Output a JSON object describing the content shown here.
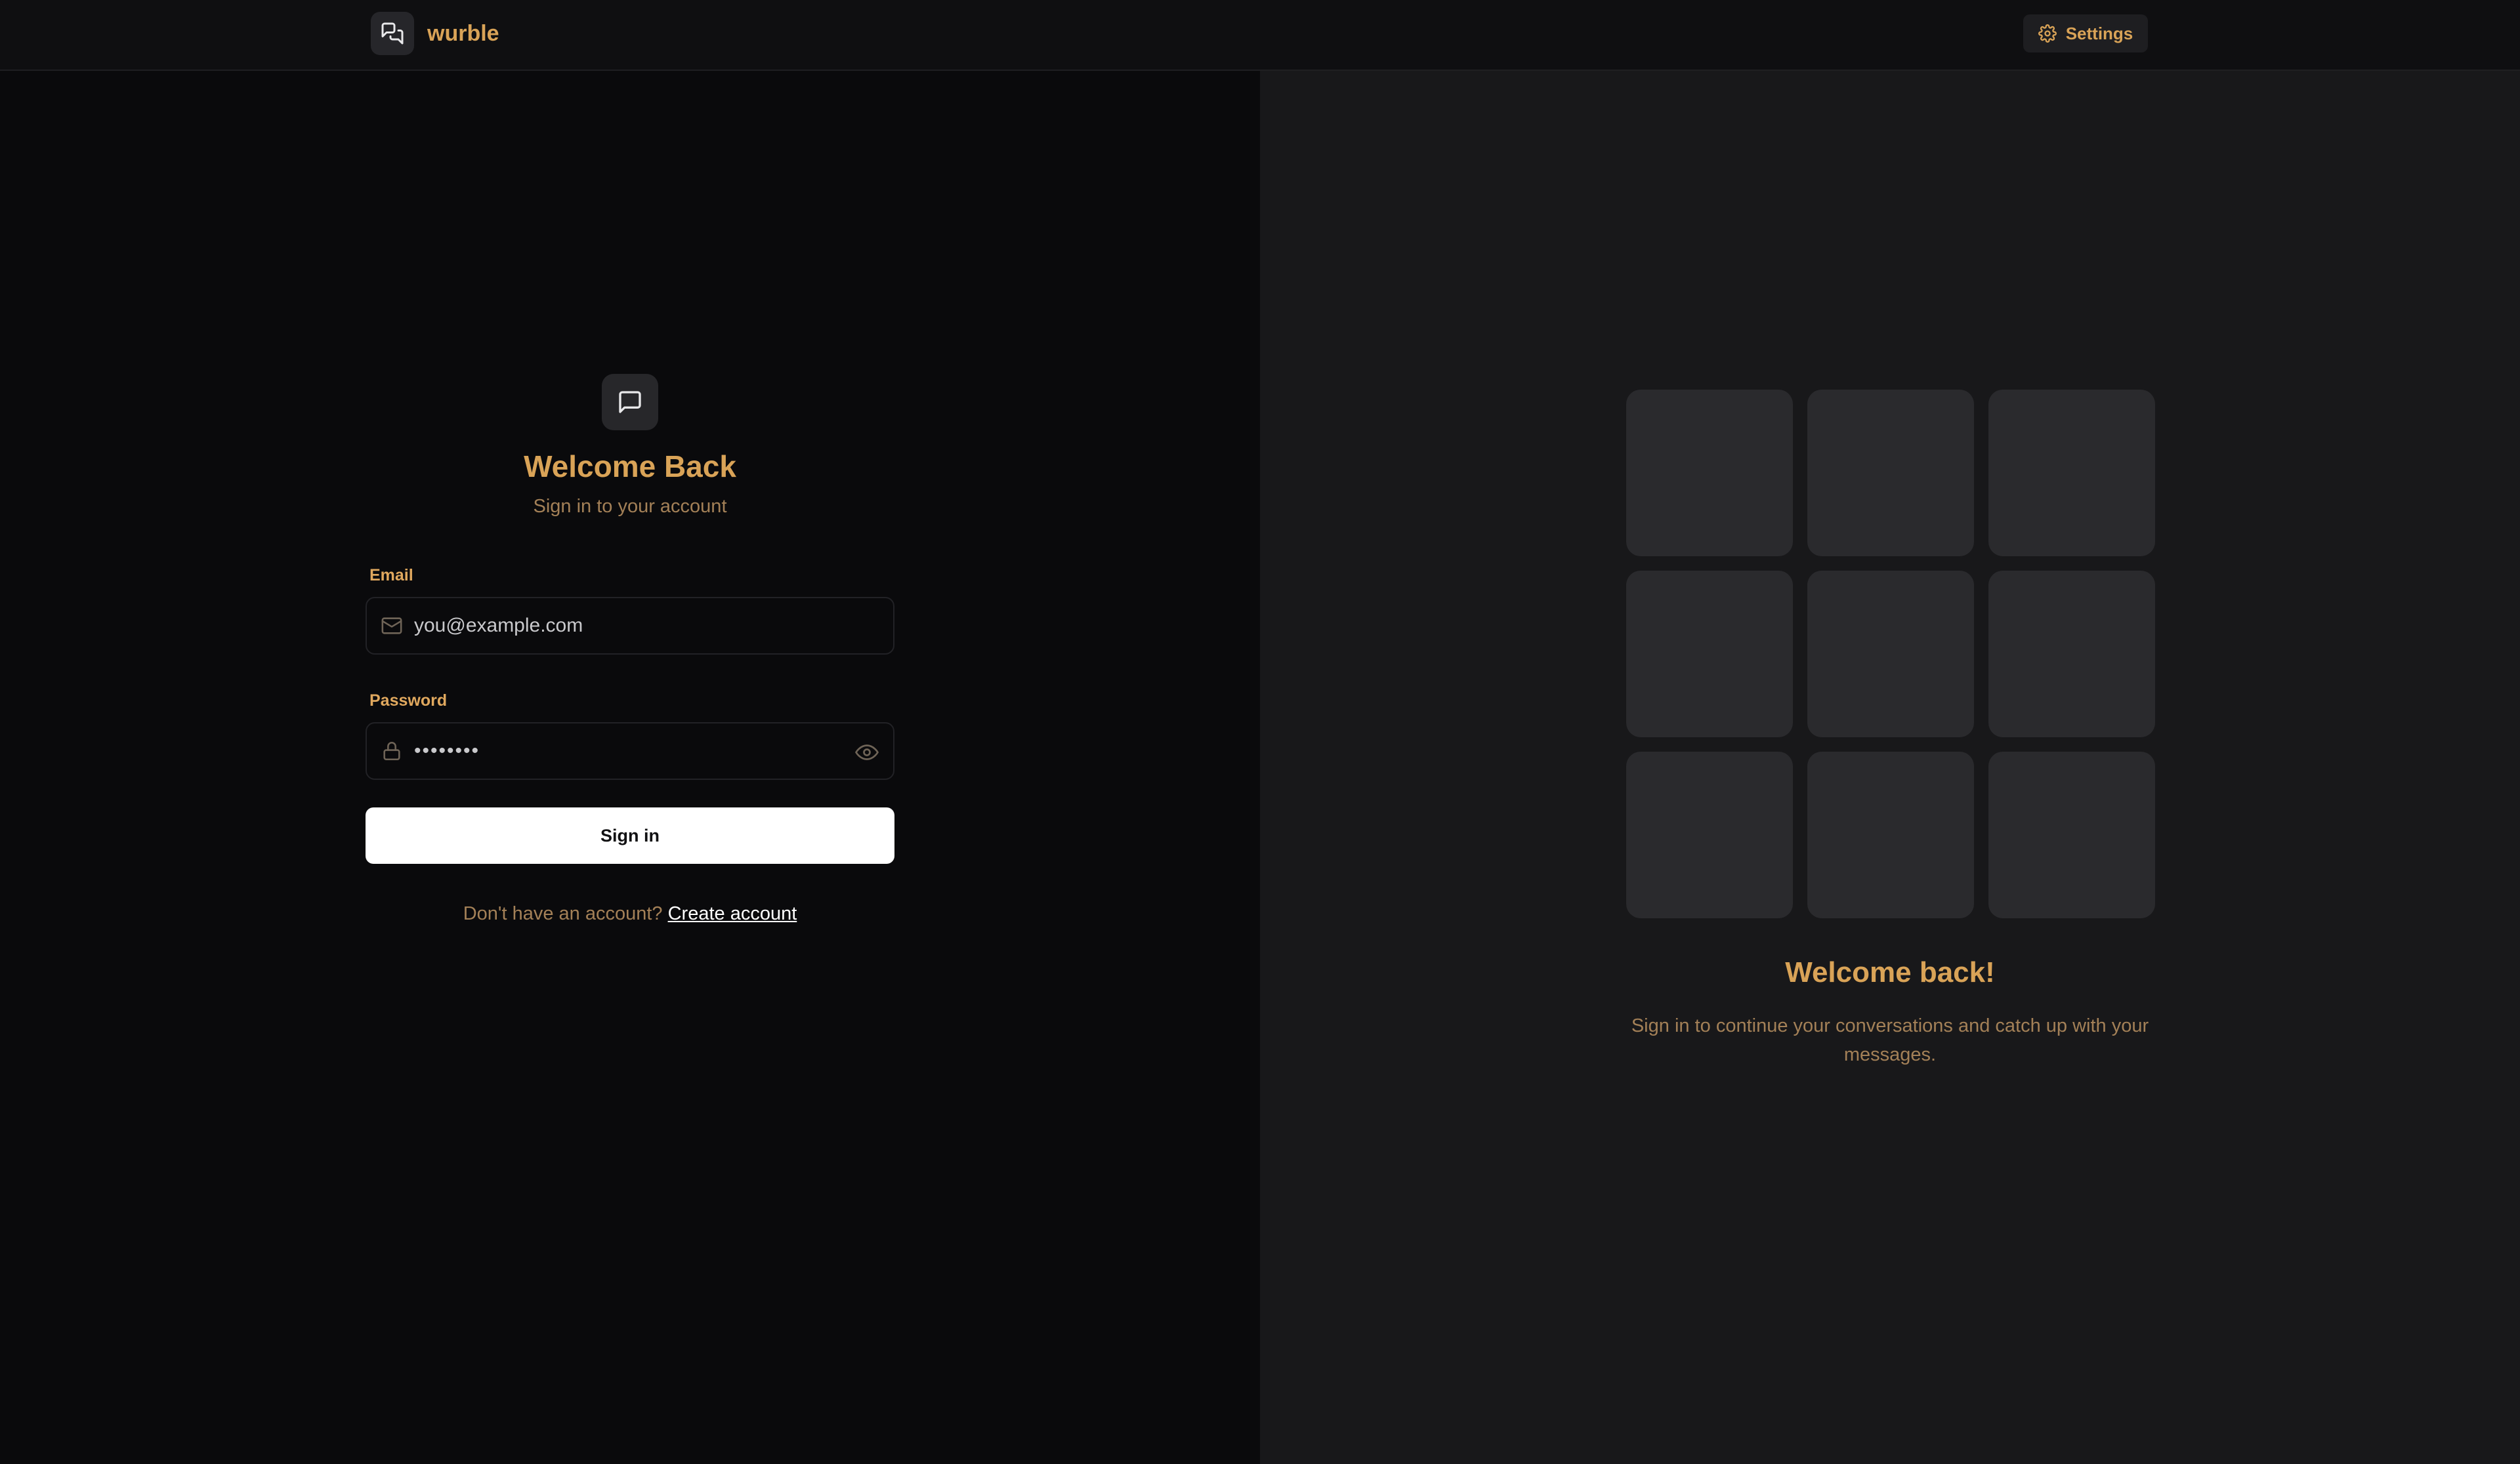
{
  "header": {
    "brand_name": "wurble",
    "settings_label": "Settings"
  },
  "login": {
    "title": "Welcome Back",
    "subtitle": "Sign in to your account",
    "email_label": "Email",
    "email_value": "you@example.com",
    "password_label": "Password",
    "password_value": "••••••••",
    "submit_label": "Sign in",
    "no_account_text": "Don't have an account?",
    "create_account_link": "Create account"
  },
  "promo": {
    "title": "Welcome back!",
    "text": "Sign in to continue your conversations and catch up with your messages.",
    "tile_count": 9
  },
  "icons": {
    "brand": "chat-bubbles-icon",
    "settings": "gear-icon",
    "logo": "chat-bubble-icon",
    "email": "mail-icon",
    "password": "lock-icon",
    "toggle": "eye-icon"
  },
  "colors": {
    "accent": "#d9a357",
    "muted": "#a38057",
    "background_left": "#0a0a0c",
    "background_right": "#18181a",
    "tile": "#2a2a2d",
    "button": "#ffffff"
  }
}
